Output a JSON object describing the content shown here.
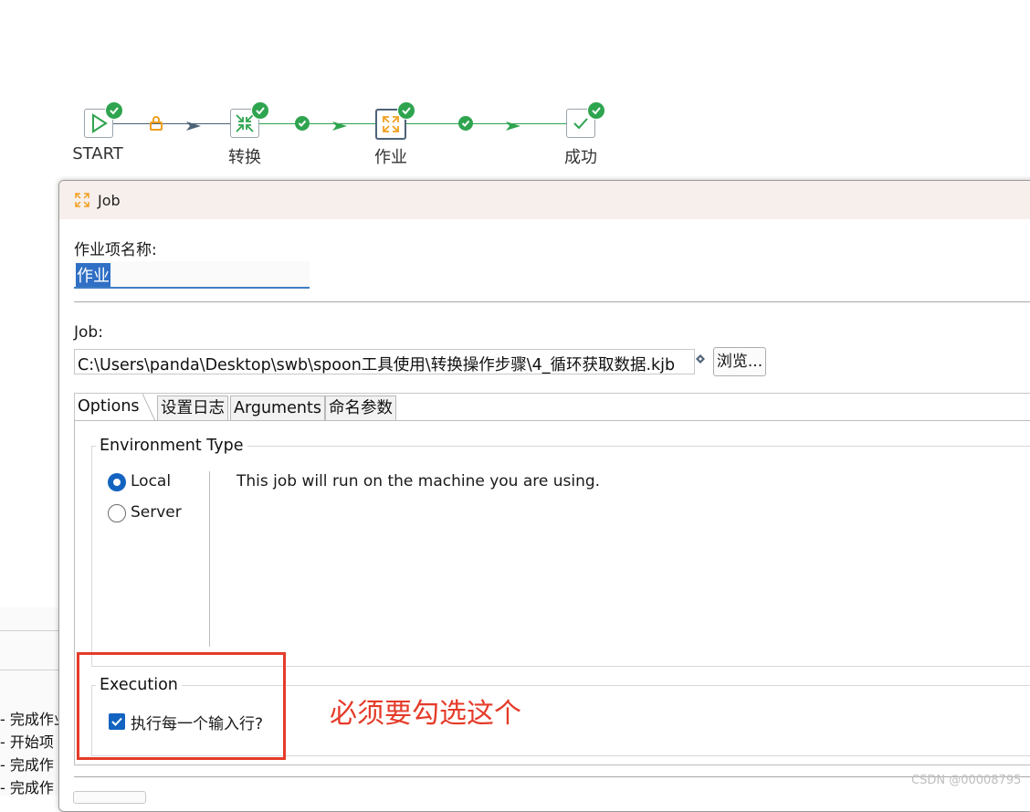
{
  "workflow": {
    "nodes": [
      {
        "label": "START",
        "icon": "play-icon",
        "status": "success"
      },
      {
        "label": "转换",
        "icon": "transformation-icon",
        "status": "success"
      },
      {
        "label": "作业",
        "icon": "job-icon",
        "status": "success",
        "selected": true
      },
      {
        "label": "成功",
        "icon": "success-check-icon",
        "status": "success"
      }
    ],
    "hops": [
      {
        "from": "START",
        "to": "转换",
        "type": "unconditional",
        "icon": "lock-icon"
      },
      {
        "from": "转换",
        "to": "作业",
        "type": "success",
        "icon": "check-circle-icon"
      },
      {
        "from": "作业",
        "to": "成功",
        "type": "success",
        "icon": "check-circle-icon"
      }
    ]
  },
  "background_log": {
    "lines": [
      "- 完成作业",
      "- 开始项",
      "- 完成作",
      "- 完成作"
    ]
  },
  "dialog": {
    "title": "Job",
    "name_label": "作业项名称:",
    "name_value": "作业",
    "job_label": "Job:",
    "job_path": "C:\\Users\\panda\\Desktop\\swb\\spoon工具使用\\转换操作步骤\\4_循环获取数据.kjb",
    "browse_label": "浏览...",
    "tabs": [
      {
        "label": "Options",
        "active": true
      },
      {
        "label": "设置日志",
        "active": false
      },
      {
        "label": "Arguments",
        "active": false
      },
      {
        "label": "命名参数",
        "active": false
      }
    ],
    "environment": {
      "title": "Environment Type",
      "options": [
        {
          "label": "Local",
          "selected": true
        },
        {
          "label": "Server",
          "selected": false
        }
      ],
      "description": "This job will run on the machine you are using."
    },
    "execution": {
      "title": "Execution",
      "checkbox_label": "执行每一个输入行?",
      "checked": true
    }
  },
  "annotation": {
    "text": "必须要勾选这个",
    "color": "#e53b29"
  },
  "watermark": "CSDN @00008795",
  "colors": {
    "accent": "#1363c0",
    "success": "#2ea44f",
    "hop": "#4d6378",
    "lock": "#f0a020",
    "job_orange": "#f0a020"
  }
}
